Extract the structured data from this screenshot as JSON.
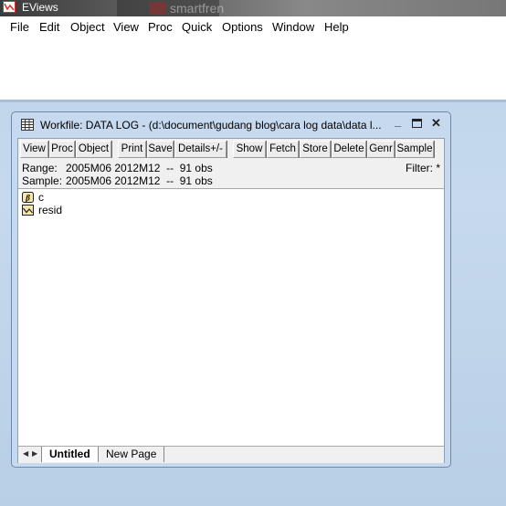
{
  "app": {
    "title": "EViews",
    "background_window_text": "smartfren"
  },
  "menu": [
    "File",
    "Edit",
    "Object",
    "View",
    "Proc",
    "Quick",
    "Options",
    "Window",
    "Help"
  ],
  "workfile": {
    "title": "Workfile: DATA LOG - (d:\\document\\gudang blog\\cara log data\\data l...",
    "toolbar": [
      "View",
      "Proc",
      "Object",
      "Print",
      "Save",
      "Details+/-",
      "Show",
      "Fetch",
      "Store",
      "Delete",
      "Genr",
      "Sample"
    ],
    "range_label": "Range:",
    "range_value": "2005M06 2012M12  --  91 obs",
    "sample_label": "Sample:",
    "sample_value": "2005M06 2012M12  --  91 obs",
    "filter": "Filter: *",
    "objects": [
      {
        "name": "c",
        "icon": "coefficient-icon"
      },
      {
        "name": "resid",
        "icon": "series-icon"
      }
    ],
    "tabs": [
      "Untitled",
      "New Page"
    ],
    "active_tab": "Untitled"
  }
}
